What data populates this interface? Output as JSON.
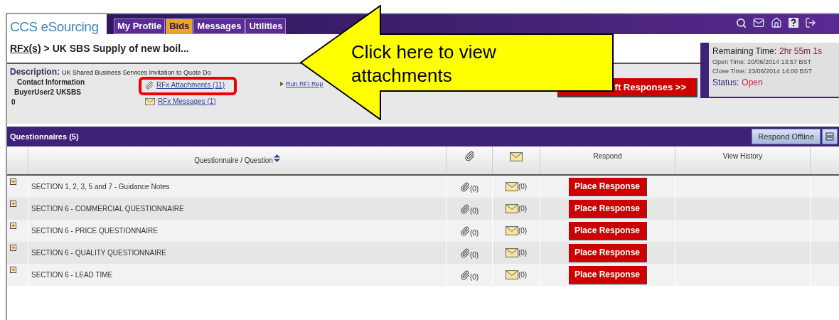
{
  "app": {
    "logo": "CCS eSourcing"
  },
  "tabs": [
    {
      "label": "My Profile",
      "selected": false
    },
    {
      "label": "Bids",
      "selected": true
    },
    {
      "label": "Messages",
      "selected": false
    },
    {
      "label": "Utilities",
      "selected": false
    }
  ],
  "breadcrumb": {
    "link": "RFx(s)",
    "current": "> UK SBS Supply of new boil..."
  },
  "details": {
    "description_label": "Description:",
    "description": "UK Shared Business Services Invitation to Quote Do",
    "contact_label": "Contact Information",
    "contact_name": "BuyerUser2 UKSBS",
    "contact_phone": "0",
    "attachments_link": "RFx Attachments (11)",
    "messages_link": "RFx Messages (1)",
    "report_link": "Run RFI Rep",
    "submit_button": "ft Responses >>"
  },
  "timer": {
    "remaining_label": "Remaining Time:",
    "remaining": "2hr 55m 1s",
    "open": "Open Time: 20/06/2014 13:57 BST",
    "close": "Close Time: 23/06/2014 14:00 BST",
    "status_label": "Status:",
    "status": "Open"
  },
  "questionnaires": {
    "title": "Questionnaires (5)",
    "offline_button": "Respond Offline",
    "question_header": "Questionnaire / Question",
    "respond_header": "Respond",
    "history_header": "View History",
    "rows": [
      {
        "title": "SECTION 1, 2, 3, 5 and 7 - Guidance Notes",
        "expanded": false,
        "attachments": "(0)",
        "messages": "(0)",
        "action": "Place Response"
      },
      {
        "title": "SECTION 6 - COMMERCIAL QUESTIONNAIRE",
        "expanded": false,
        "attachments": "(0)",
        "messages": "(0)",
        "action": "Place Response"
      },
      {
        "title": "SECTION 6 - PRICE QUESTIONNAIRE",
        "expanded": false,
        "attachments": "(0)",
        "messages": "(0)",
        "action": "Place Response"
      },
      {
        "title": "SECTION 6 - QUALITY QUESTIONNAIRE",
        "expanded": false,
        "attachments": "(0)",
        "messages": "(0)",
        "action": "Place Response"
      },
      {
        "title": "SECTION 6 - LEAD TIME",
        "expanded": false,
        "attachments": "(0)",
        "messages": "(0)",
        "action": "Place Response"
      }
    ]
  },
  "callout": {
    "text": "Click here to view attachments"
  }
}
